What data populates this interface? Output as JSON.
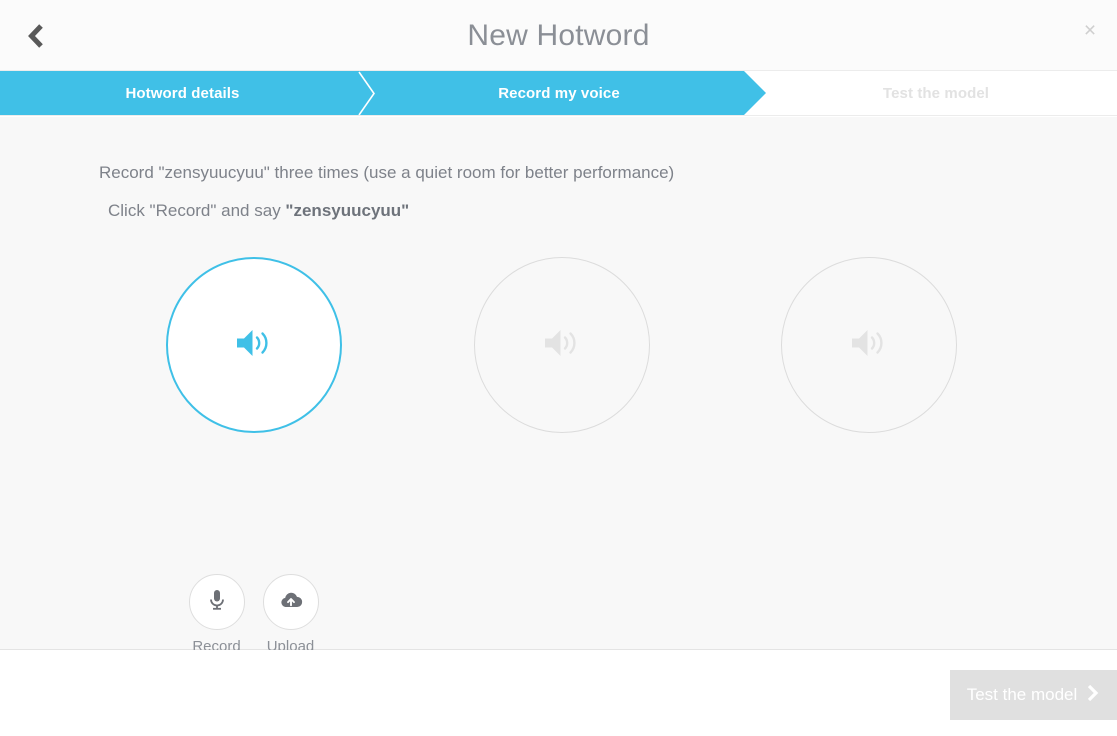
{
  "header": {
    "title": "New Hotword",
    "back_icon": "chevron-left-icon",
    "close_icon": "close-icon",
    "close_label": "×"
  },
  "steps": [
    {
      "label": "Hotword details",
      "state": "complete"
    },
    {
      "label": "Record my voice",
      "state": "current"
    },
    {
      "label": "Test the model",
      "state": "upcoming"
    }
  ],
  "instructions": {
    "line1": "Record \"zensyuucyuu\" three times (use a quiet room for better performance)",
    "line2_prefix": "Click \"Record\" and say ",
    "hotword_quoted": "\"zensyuucyuu\""
  },
  "recordings": [
    {
      "index": 1,
      "state": "active",
      "icon": "speaker-icon"
    },
    {
      "index": 2,
      "state": "empty",
      "icon": "speaker-icon"
    },
    {
      "index": 3,
      "state": "empty",
      "icon": "speaker-icon"
    }
  ],
  "controls": [
    {
      "label": "Record",
      "icon": "microphone-icon"
    },
    {
      "label": "Upload",
      "icon": "cloud-upload-icon"
    }
  ],
  "footer": {
    "next_label": "Test the model",
    "next_icon": "chevron-right-icon",
    "next_disabled": true
  },
  "colors": {
    "accent": "#40c0e7",
    "panel": "#f8f8f8",
    "text_muted": "#7e828a",
    "disabled_button": "#e0e0e0",
    "idle_outline": "#dcdcdc"
  }
}
